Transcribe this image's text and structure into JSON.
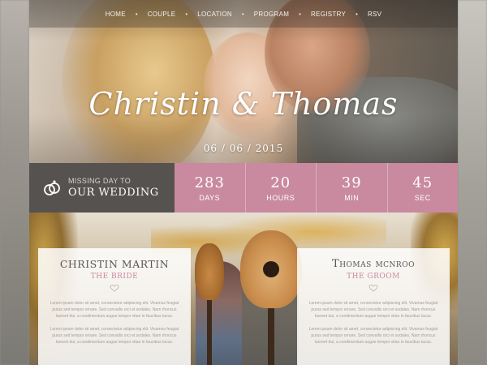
{
  "nav": {
    "items": [
      "HOME",
      "COUPLE",
      "LOCATION",
      "PROGRAM",
      "REGISTRY",
      "RSV"
    ],
    "separator": "•"
  },
  "hero": {
    "title": "Christin & Thomas",
    "date": "06 / 06 / 2015"
  },
  "countdown": {
    "label_small": "MISSING DAY TO",
    "label_big": "OUR WEDDING",
    "cells": [
      {
        "value": "283",
        "unit": "DAYS"
      },
      {
        "value": "20",
        "unit": "HOURS"
      },
      {
        "value": "39",
        "unit": "MIN"
      },
      {
        "value": "45",
        "unit": "SEC"
      }
    ]
  },
  "bride": {
    "name": "Christin Martin",
    "role": "THE BRIDE",
    "para1": "Lorem ipsum dolor sit amet, consectetur adipiscing elit. Vivamus feugiat purus sed tempor ornare. Sed convallis orci et sodales. Nam rhoncus laoreet dui, a condimentum augue tempor vitae in faucibus lacus.",
    "para2": "Lorem ipsum dolor sit amet, consectetur adipiscing elit. Vivamus feugiat purus sed tempor ornare. Sed convallis orci et sodales. Nam rhoncus laoreet dui, a condimentum augue tempor vitae in faucibus lacus."
  },
  "groom": {
    "name": "Thomas mcnroo",
    "role": "THE GROOM",
    "para1": "Lorem ipsum dolor sit amet, consectetur adipiscing elit. Vivamus feugiat purus sed tempor ornare. Sed convallis orci et sodales. Nam rhoncus laoreet dui, a condimentum augue tempor vitae in faucibus lacus.",
    "para2": "Lorem ipsum dolor sit amet, consectetur adipiscing elit. Vivamus feugiat purus sed tempor ornare. Sed convallis orci et sodales. Nam rhoncus laoreet dui, a condimentum augue tempor vitae in faucibus lacus."
  },
  "colors": {
    "accent_pink": "#c9899f",
    "dark_label": "#565250"
  }
}
